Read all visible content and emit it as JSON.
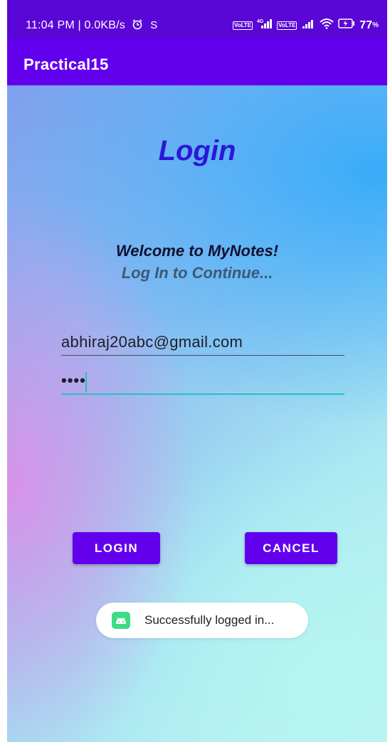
{
  "status_bar": {
    "time_network": "11:04 PM | 0.0KB/s",
    "alarm_icon": "alarm-clock-icon",
    "extra_icon": "s-notification-icon",
    "sim1_badge": "Vo LTE",
    "network_type": "4G",
    "sim2_badge": "Vo LTE",
    "battery": "77"
  },
  "app_bar": {
    "title": "Practical15",
    "color": "#6200ee"
  },
  "screen": {
    "heading": "Login",
    "welcome": "Welcome to MyNotes!",
    "subtitle": "Log In to Continue..."
  },
  "form": {
    "email_value": "abhiraj20abc@gmail.com",
    "password_value": "••••"
  },
  "buttons": {
    "login_label": "LOGIN",
    "cancel_label": "CANCEL"
  },
  "toast": {
    "message": "Successfully logged in...",
    "icon": "android-app-icon"
  },
  "colors": {
    "accent": "#6200ee",
    "status_bar": "#5a06d6",
    "focus_underline": "#1fc4c2",
    "heading": "#2a17d8"
  }
}
